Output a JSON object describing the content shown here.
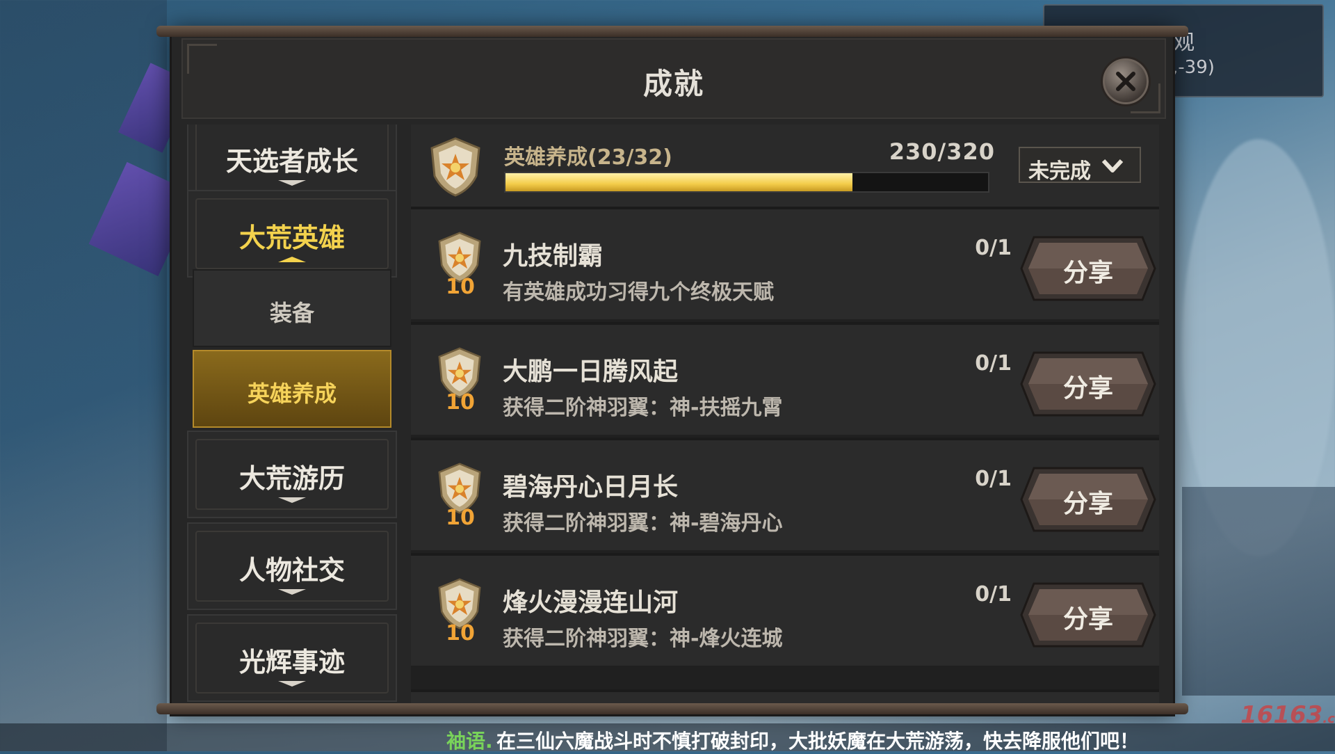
{
  "minimap": {
    "title": "观",
    "coord": ",-39)"
  },
  "panel": {
    "title": "成就"
  },
  "sidebar": {
    "items": [
      {
        "label": "天选者成长"
      },
      {
        "label": "大荒英雄"
      },
      {
        "label": "大荒游历"
      },
      {
        "label": "人物社交"
      },
      {
        "label": "光辉事迹"
      }
    ],
    "sub_items": [
      {
        "label": "装备"
      },
      {
        "label": "英雄养成"
      }
    ]
  },
  "summary": {
    "category": "英雄养成(23/32)",
    "points": "230/320",
    "progress_fraction": 0.719,
    "filter_label": "未完成"
  },
  "achievements": [
    {
      "points": "10",
      "name": "九技制霸",
      "desc": "有英雄成功习得九个终极天赋",
      "progress": "0/1",
      "share": "分享"
    },
    {
      "points": "10",
      "name": "大鹏一日腾风起",
      "desc": "获得二阶神羽翼：神-扶摇九霄",
      "progress": "0/1",
      "share": "分享"
    },
    {
      "points": "10",
      "name": "碧海丹心日月长",
      "desc": "获得二阶神羽翼：神-碧海丹心",
      "progress": "0/1",
      "share": "分享"
    },
    {
      "points": "10",
      "name": "烽火漫漫连山河",
      "desc": "获得二阶神羽翼：神-烽火连城",
      "progress": "0/1",
      "share": "分享"
    }
  ],
  "chat": {
    "speaker": "袖语.",
    "message": "在三仙六魔战斗时不慎打破封印，大批妖魔在大荒游荡，快去降服他们吧！"
  },
  "watermark": {
    "main": "16163",
    "suffix": ".com"
  },
  "colors": {
    "gold": "#f3d24d",
    "points_orange": "#f1a436",
    "speaker_green": "#79d35a"
  }
}
